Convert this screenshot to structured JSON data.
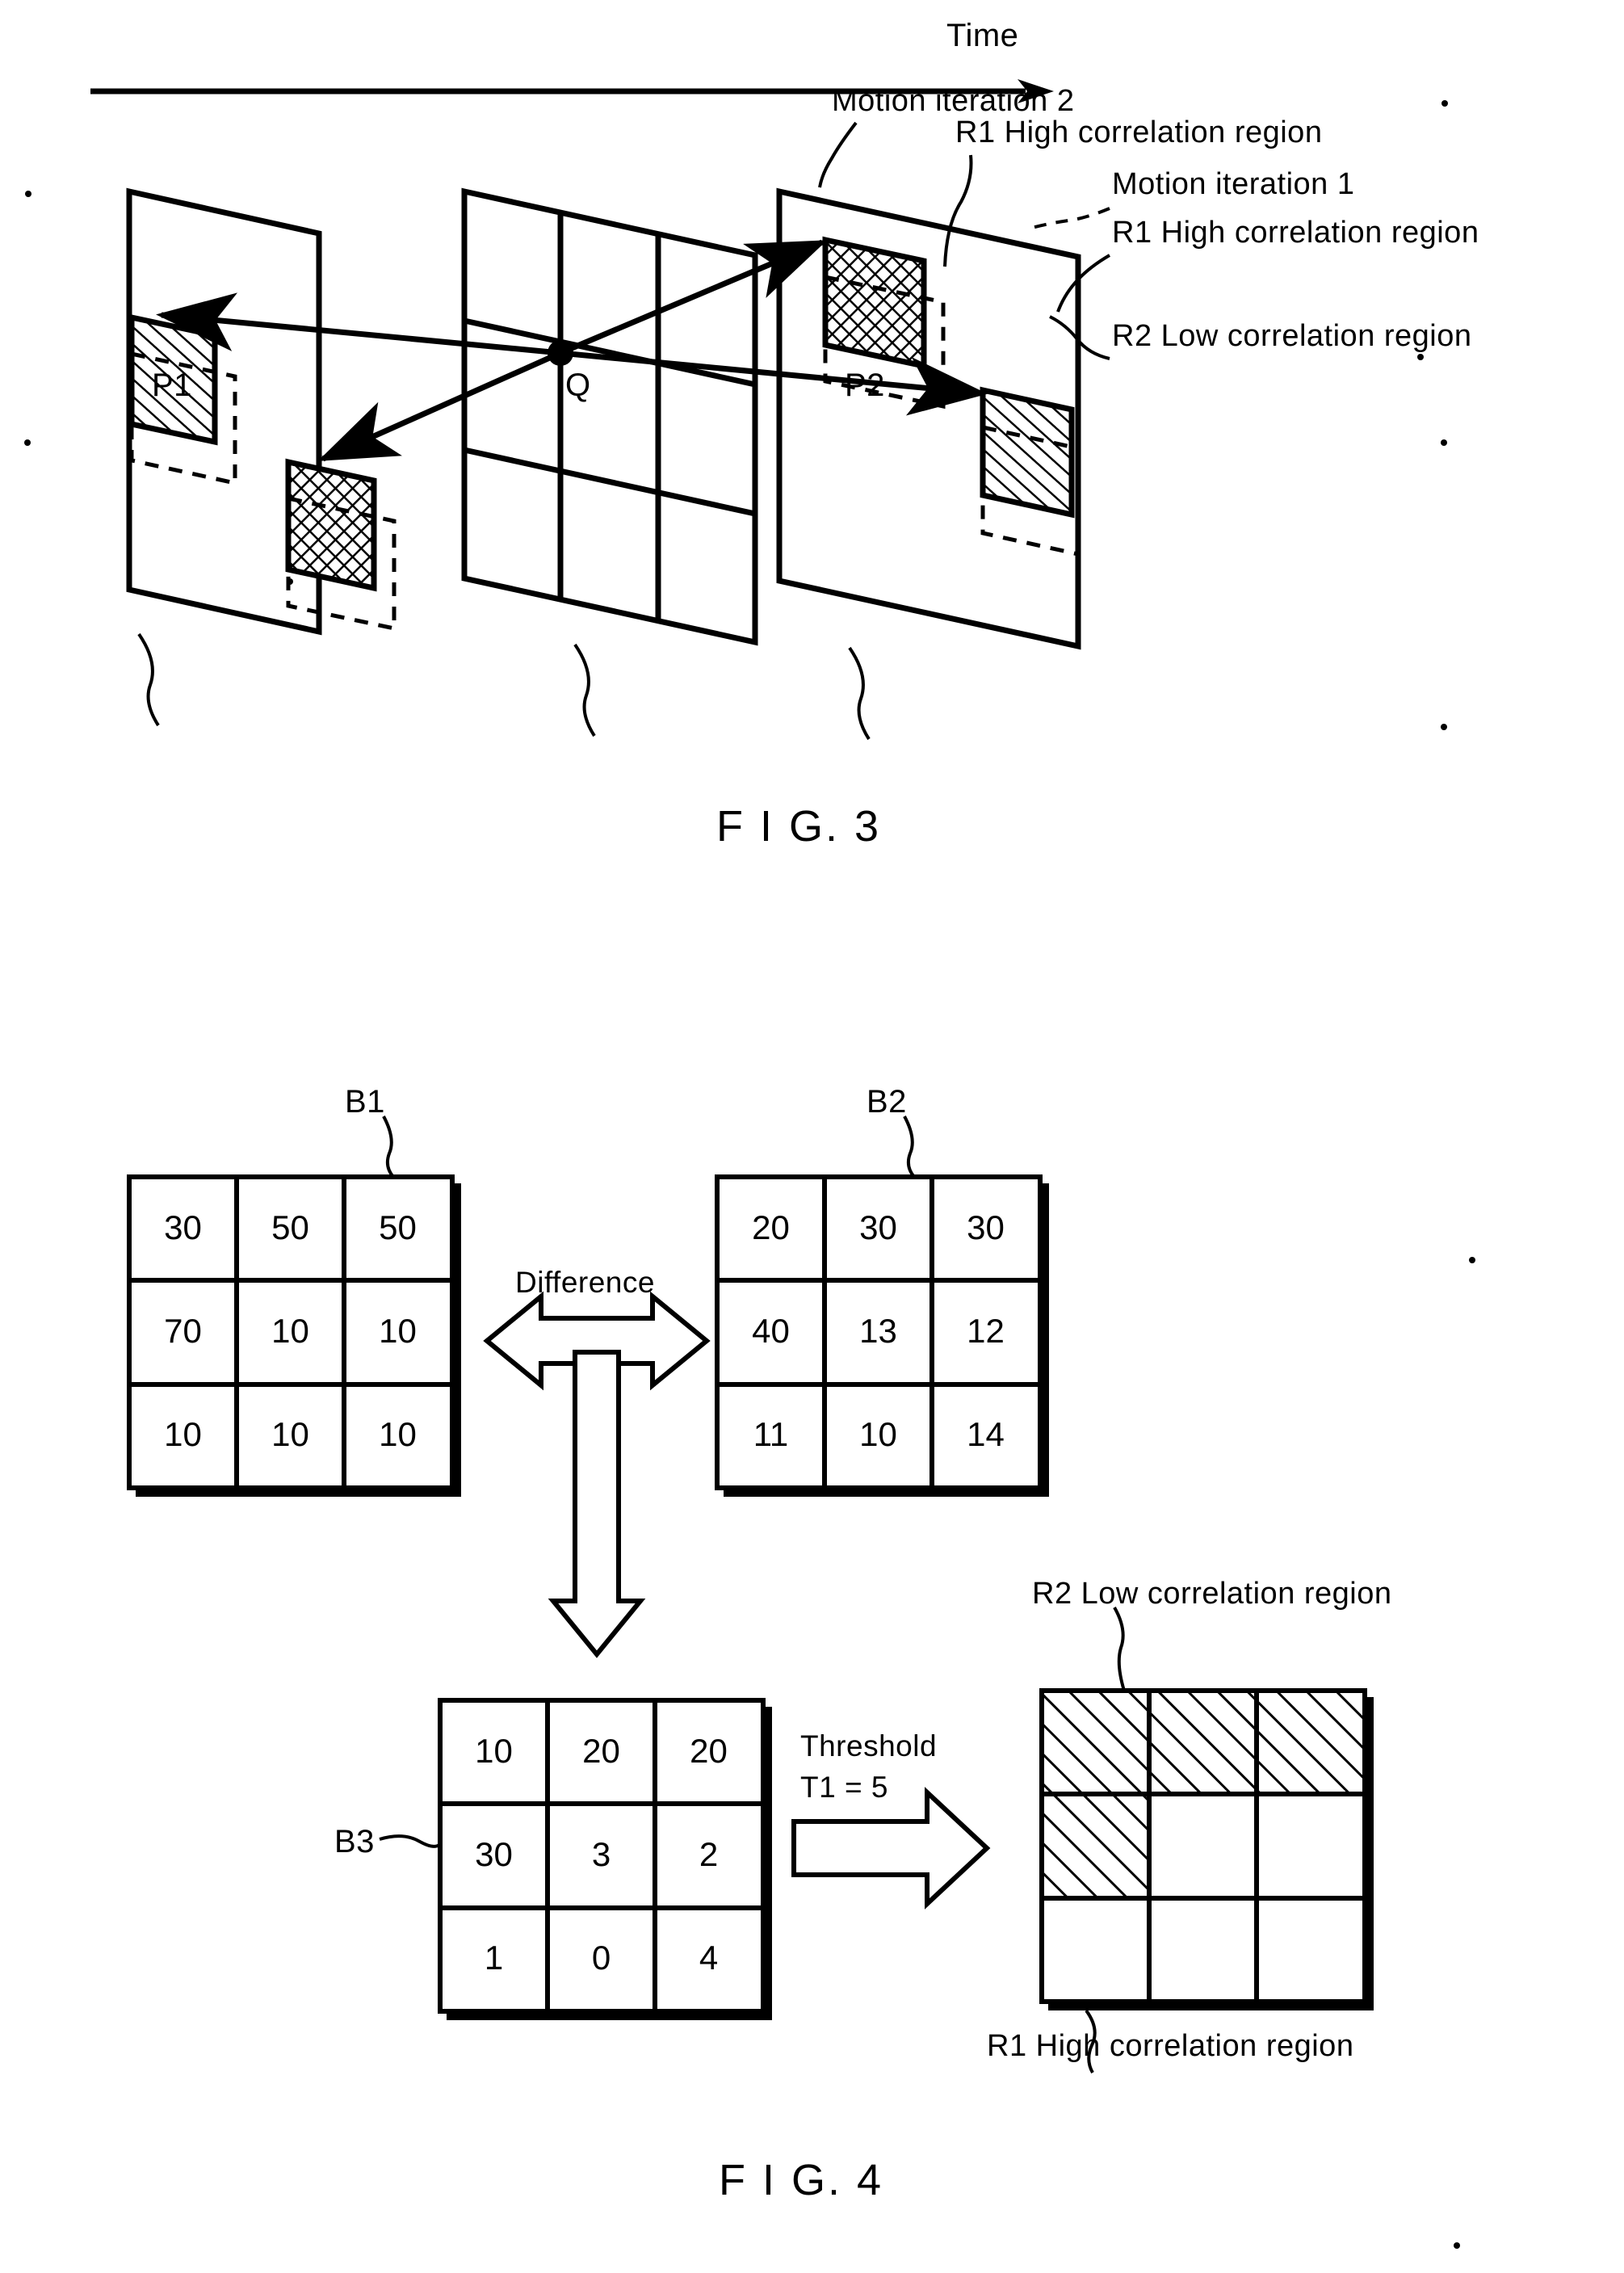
{
  "figure3": {
    "axis_label": "Time",
    "annotations": {
      "motion_iteration_2": "Motion iteration 2",
      "r1_high_top": "R1 High correlation region",
      "motion_iteration_1": "Motion iteration 1",
      "r1_high_mid": "R1 High correlation region",
      "r2_low": "R2 Low correlation region"
    },
    "plane_labels": {
      "p1": "P1",
      "q": "Q",
      "p2": "P2"
    },
    "caption": "F I G. 3"
  },
  "figure4": {
    "labels": {
      "b1": "B1",
      "b2": "B2",
      "b3": "B3",
      "difference": "Difference",
      "threshold_line1": "Threshold",
      "threshold_line2": "T1 = 5",
      "r2_low": "R2 Low correlation region",
      "r1_high": "R1 High correlation region"
    },
    "caption": "F I G. 4",
    "matrices": {
      "B1": [
        [
          30,
          50,
          50
        ],
        [
          70,
          10,
          10
        ],
        [
          10,
          10,
          10
        ]
      ],
      "B2": [
        [
          20,
          30,
          30
        ],
        [
          40,
          13,
          12
        ],
        [
          11,
          10,
          14
        ]
      ],
      "B3": [
        [
          10,
          20,
          20
        ],
        [
          30,
          3,
          2
        ],
        [
          1,
          0,
          4
        ]
      ],
      "result_mask": [
        [
          1,
          1,
          1
        ],
        [
          1,
          0,
          0
        ],
        [
          0,
          0,
          0
        ]
      ]
    }
  },
  "colors": {
    "ink": "#000000",
    "paper": "#ffffff"
  }
}
